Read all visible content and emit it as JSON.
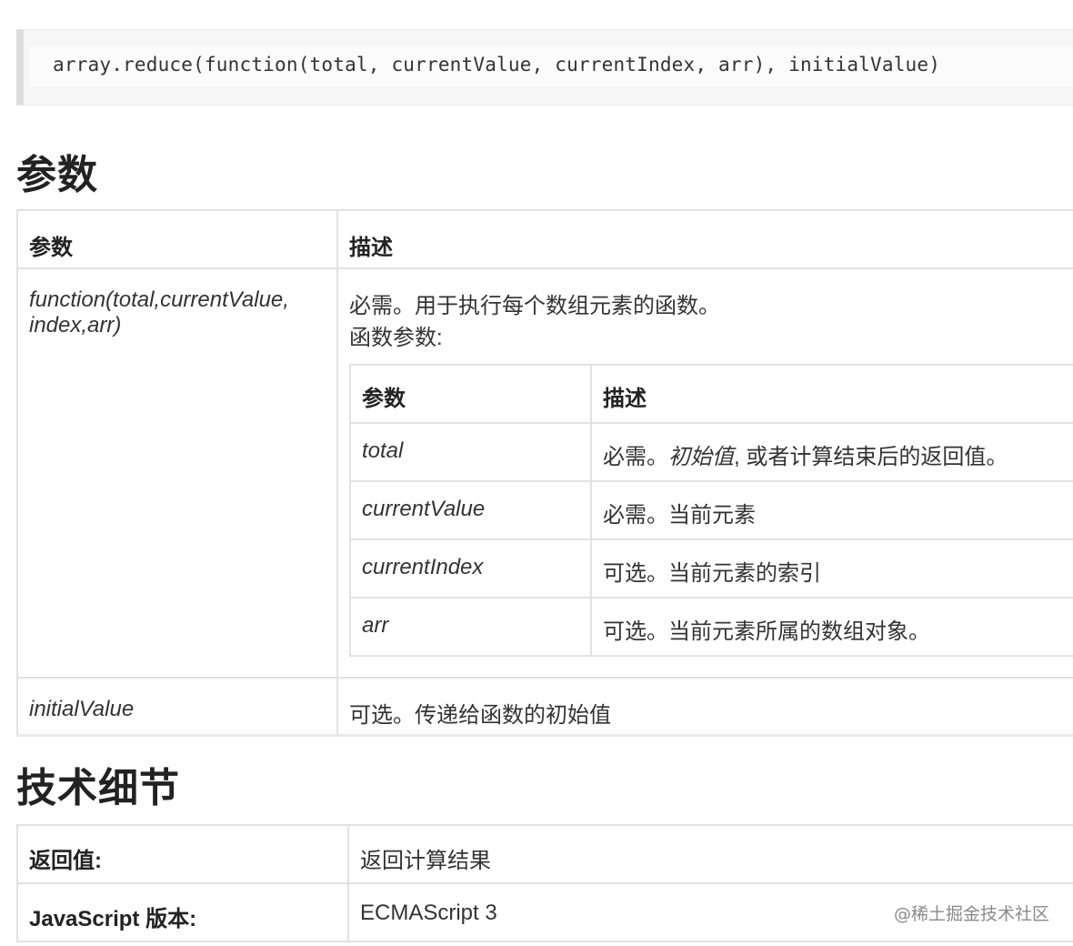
{
  "code": "array.reduce(function(total, currentValue, currentIndex, arr), initialValue)",
  "sections": {
    "params_title": "参数",
    "tech_title": "技术细节"
  },
  "params_table": {
    "headers": [
      "参数",
      "描述"
    ],
    "row1": {
      "name": "function(total,currentValue, index,arr)",
      "desc_line1": "必需。用于执行每个数组元素的函数。",
      "desc_line2": "函数参数:",
      "nested": {
        "headers": [
          "参数",
          "描述"
        ],
        "rows": [
          {
            "name": "total",
            "desc_prefix": "必需。",
            "desc_italic": "初始值",
            "desc_suffix": ", 或者计算结束后的返回值。"
          },
          {
            "name": "currentValue",
            "desc": "必需。当前元素"
          },
          {
            "name": "currentIndex",
            "desc": "可选。当前元素的索引"
          },
          {
            "name": "arr",
            "desc": "可选。当前元素所属的数组对象。"
          }
        ]
      }
    },
    "row2": {
      "name": "initialValue",
      "desc": "可选。传递给函数的初始值"
    }
  },
  "tech_table": {
    "rows": [
      {
        "label": "返回值:",
        "value": "返回计算结果"
      },
      {
        "label": "JavaScript 版本:",
        "value": "ECMAScript 3"
      }
    ]
  },
  "watermark": "@稀土掘金技术社区"
}
